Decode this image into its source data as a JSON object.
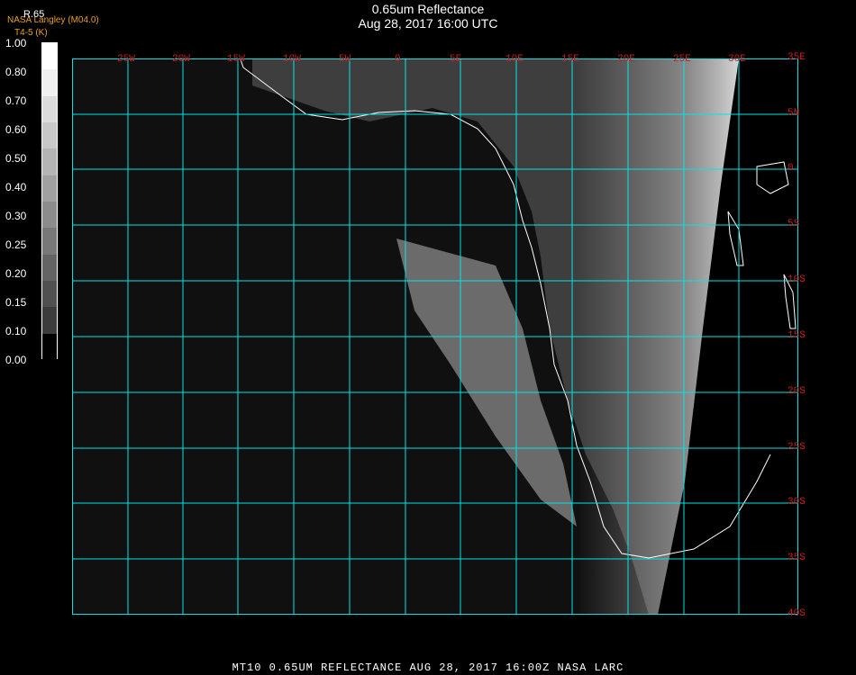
{
  "title": "0.65um Reflectance",
  "timestamp": "Aug 28, 2017 16:00 UTC",
  "credit_line1": "NASA Langley (M04.0)",
  "credit_line2": "T4-5 (K)",
  "scale_label": "R.65",
  "colorbar": {
    "ticks": [
      "1.00",
      "0.80",
      "0.70",
      "0.60",
      "0.50",
      "0.40",
      "0.30",
      "0.25",
      "0.20",
      "0.15",
      "0.10",
      "0.00"
    ],
    "shades": [
      "#ffffff",
      "#f0f0f0",
      "#dcdcdc",
      "#c8c8c8",
      "#b4b4b4",
      "#a0a0a0",
      "#8c8c8c",
      "#787878",
      "#646464",
      "#505050",
      "#3c3c3c",
      "#000000"
    ]
  },
  "grid": {
    "lon_labels": [
      "25W",
      "20W",
      "15W",
      "10W",
      "5W",
      "0",
      "5E",
      "10E",
      "15E",
      "20E",
      "25E",
      "30E"
    ],
    "lat_labels": [
      "35E",
      "5N",
      "0",
      "5S",
      "10S",
      "15S",
      "20S",
      "25S",
      "30S",
      "35S",
      "40S"
    ],
    "grid_color": "#00e5e5",
    "label_color": "#d02020"
  },
  "footer": "MT10  0.65UM REFLECTANCE   AUG 28, 2017 16:00Z   NASA LARC"
}
